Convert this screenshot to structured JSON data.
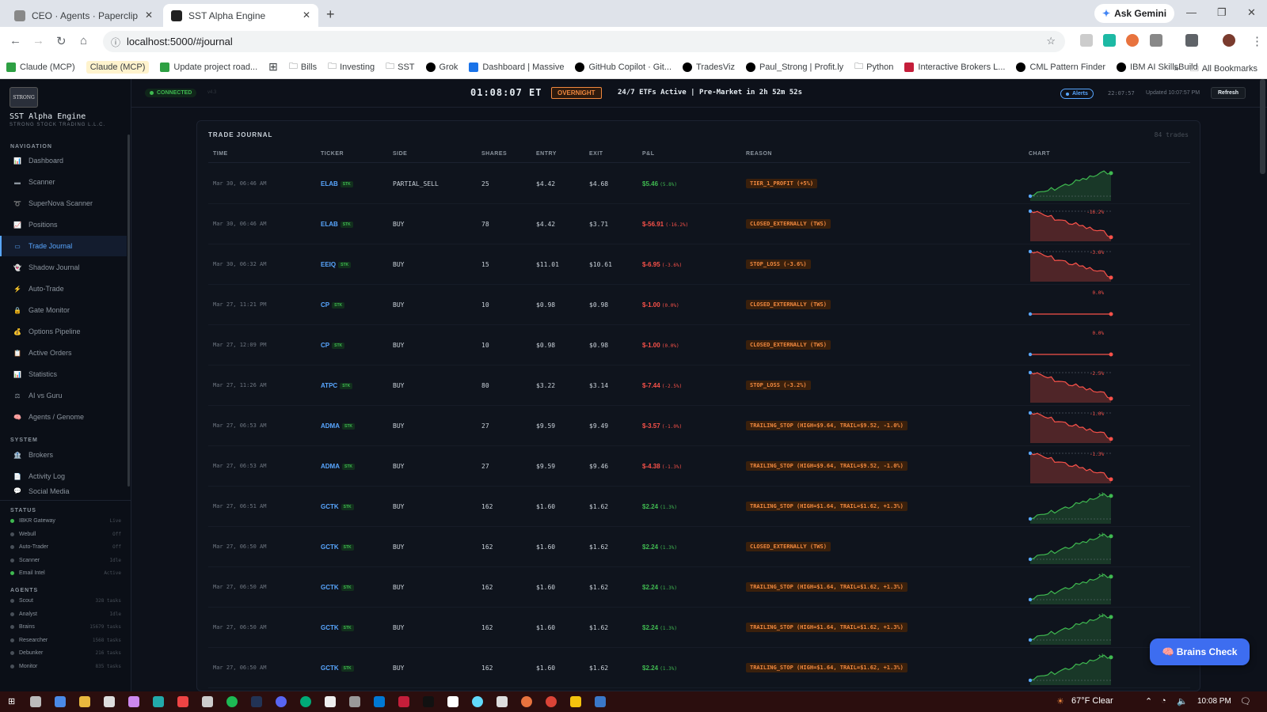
{
  "browser": {
    "tabs": [
      {
        "title": "CEO · Agents · Paperclip"
      },
      {
        "title": "SST Alpha Engine"
      }
    ],
    "ask_gemini": "Ask Gemini",
    "url": "localhost:5000/#journal",
    "bookmarks": [
      {
        "label": "Claude (MCP)",
        "color": "#2ea043",
        "highlight": false
      },
      {
        "label": "Claude (MCP)",
        "color": "",
        "highlight": true
      },
      {
        "label": "Update project road...",
        "color": "#2ea043",
        "highlight": false
      },
      {
        "label": "",
        "color": "#5f6368",
        "highlight": false,
        "icon": "apps-grid-icon"
      },
      {
        "label": "Bills",
        "color": "",
        "icon": "folder-icon"
      },
      {
        "label": "Investing",
        "color": "",
        "icon": "folder-icon"
      },
      {
        "label": "SST",
        "color": "",
        "icon": "folder-icon"
      },
      {
        "label": "Grok",
        "color": "#000000"
      },
      {
        "label": "Dashboard | Massive",
        "color": "#1a73e8"
      },
      {
        "label": "GitHub Copilot · Git...",
        "color": "#000000"
      },
      {
        "label": "TradesViz",
        "color": "#000000"
      },
      {
        "label": "Paul_Strong | Profit.ly",
        "color": "#000000"
      },
      {
        "label": "Python",
        "color": "",
        "icon": "folder-icon"
      },
      {
        "label": "Interactive Brokers L...",
        "color": "#c41e3a"
      },
      {
        "label": "CML Pattern Finder",
        "color": "#000000"
      },
      {
        "label": "IBM AI SkillsBuild",
        "color": "#000000"
      }
    ],
    "all_bookmarks": "All Bookmarks"
  },
  "sidebar": {
    "logo_text": "STRONG",
    "brand": "SST Alpha Engine",
    "brand_sub": "STRONG STOCK TRADING L.L.C.",
    "nav_title": "NAVIGATION",
    "nav": [
      {
        "label": "Dashboard",
        "icon": "📊",
        "active": false
      },
      {
        "label": "Scanner",
        "icon": "▬",
        "active": false
      },
      {
        "label": "SuperNova Scanner",
        "icon": "➰",
        "active": false
      },
      {
        "label": "Positions",
        "icon": "📈",
        "active": false
      },
      {
        "label": "Trade Journal",
        "icon": "▭",
        "active": true
      },
      {
        "label": "Shadow Journal",
        "icon": "👻",
        "active": false
      },
      {
        "label": "Auto-Trade",
        "icon": "⚡",
        "active": false
      },
      {
        "label": "Gate Monitor",
        "icon": "🔒",
        "active": false
      },
      {
        "label": "Options Pipeline",
        "icon": "💰",
        "active": false
      },
      {
        "label": "Active Orders",
        "icon": "📋",
        "active": false
      },
      {
        "label": "Statistics",
        "icon": "📊",
        "active": false
      },
      {
        "label": "AI vs Guru",
        "icon": "⚖",
        "active": false
      },
      {
        "label": "Agents / Genome",
        "icon": "🧠",
        "active": false
      }
    ],
    "system_title": "SYSTEM",
    "system": [
      {
        "label": "Brokers",
        "icon": "🏦"
      },
      {
        "label": "Activity Log",
        "icon": "📄"
      },
      {
        "label": "Social Media",
        "icon": "💬"
      }
    ],
    "status_title": "STATUS",
    "status": [
      {
        "label": "IBKR Gateway",
        "value": "Live",
        "color": "#3fb950"
      },
      {
        "label": "Webull",
        "value": "Off",
        "color": "#484f58"
      },
      {
        "label": "Auto-Trader",
        "value": "Off",
        "color": "#484f58"
      },
      {
        "label": "Scanner",
        "value": "Idle",
        "color": "#484f58"
      },
      {
        "label": "Email Intel",
        "value": "Active",
        "color": "#3fb950"
      }
    ],
    "agents_title": "AGENTS",
    "agents": [
      {
        "label": "Scout",
        "value": "328 tasks",
        "color": "#484f58"
      },
      {
        "label": "Analyst",
        "value": "Idle",
        "color": "#484f58"
      },
      {
        "label": "Brains",
        "value": "15679 tasks",
        "color": "#484f58"
      },
      {
        "label": "Researcher",
        "value": "1568 tasks",
        "color": "#484f58"
      },
      {
        "label": "Debunker",
        "value": "216 tasks",
        "color": "#484f58"
      },
      {
        "label": "Monitor",
        "value": "835 tasks",
        "color": "#484f58"
      }
    ]
  },
  "topbar": {
    "connected": "CONNECTED",
    "version": "v4.3",
    "clock": "01:08:07 ET",
    "session": "OVERNIGHT",
    "market": "24/7 ETFs Active | Pre-Market in 2h 52m 52s",
    "alerts": "Alerts",
    "time": "22:07:57",
    "updated": "Updated 10:07:57 PM",
    "refresh": "Refresh"
  },
  "journal": {
    "title": "TRADE JOURNAL",
    "count": "84 trades",
    "headers": [
      "TIME",
      "TICKER",
      "SIDE",
      "SHARES",
      "ENTRY",
      "EXIT",
      "P&L",
      "REASON",
      "CHART"
    ],
    "rows": [
      {
        "time": "Mar 30, 06:46 AM",
        "ticker": "ELAB",
        "badge": "STK",
        "side": "PARTIAL_SELL",
        "shares": "25",
        "entry": "$4.42",
        "exit": "$4.68",
        "pnl": "$5.46",
        "pct": "(5.8%)",
        "reason": "TIER_1_PROFIT (+5%)",
        "positive": true,
        "chart_label": "",
        "trend": "up"
      },
      {
        "time": "Mar 30, 06:46 AM",
        "ticker": "ELAB",
        "badge": "STK",
        "side": "BUY",
        "shares": "78",
        "entry": "$4.42",
        "exit": "$3.71",
        "pnl": "$-56.91",
        "pct": "(-16.2%)",
        "reason": "CLOSED_EXTERNALLY (TWS)",
        "positive": false,
        "chart_label": "-16.2%",
        "trend": "down"
      },
      {
        "time": "Mar 30, 06:32 AM",
        "ticker": "EEIQ",
        "badge": "STK",
        "side": "BUY",
        "shares": "15",
        "entry": "$11.01",
        "exit": "$10.61",
        "pnl": "$-6.95",
        "pct": "(-3.6%)",
        "reason": "STOP_LOSS (-3.6%)",
        "positive": false,
        "chart_label": "-3.6%",
        "trend": "down"
      },
      {
        "time": "Mar 27, 11:21 PM",
        "ticker": "CP",
        "badge": "STK",
        "side": "BUY",
        "shares": "10",
        "entry": "$0.98",
        "exit": "$0.98",
        "pnl": "$-1.00",
        "pct": "(0.0%)",
        "reason": "CLOSED_EXTERNALLY (TWS)",
        "positive": false,
        "chart_label": "0.0%",
        "trend": "flat"
      },
      {
        "time": "Mar 27, 12:09 PM",
        "ticker": "CP",
        "badge": "STK",
        "side": "BUY",
        "shares": "10",
        "entry": "$0.98",
        "exit": "$0.98",
        "pnl": "$-1.00",
        "pct": "(0.0%)",
        "reason": "CLOSED_EXTERNALLY (TWS)",
        "positive": false,
        "chart_label": "0.0%",
        "trend": "flat"
      },
      {
        "time": "Mar 27, 11:26 AM",
        "ticker": "ATPC",
        "badge": "STK",
        "side": "BUY",
        "shares": "80",
        "entry": "$3.22",
        "exit": "$3.14",
        "pnl": "$-7.44",
        "pct": "(-2.5%)",
        "reason": "STOP_LOSS (-3.2%)",
        "positive": false,
        "chart_label": "-2.5%",
        "trend": "down"
      },
      {
        "time": "Mar 27, 06:53 AM",
        "ticker": "ADMA",
        "badge": "STK",
        "side": "BUY",
        "shares": "27",
        "entry": "$9.59",
        "exit": "$9.49",
        "pnl": "$-3.57",
        "pct": "(-1.0%)",
        "reason": "TRAILING_STOP (HIGH=$9.64, TRAIL=$9.52, -1.0%)",
        "positive": false,
        "chart_label": "-1.0%",
        "trend": "down"
      },
      {
        "time": "Mar 27, 06:53 AM",
        "ticker": "ADMA",
        "badge": "STK",
        "side": "BUY",
        "shares": "27",
        "entry": "$9.59",
        "exit": "$9.46",
        "pnl": "$-4.38",
        "pct": "(-1.3%)",
        "reason": "TRAILING_STOP (HIGH=$9.64, TRAIL=$9.52, -1.0%)",
        "positive": false,
        "chart_label": "-1.3%",
        "trend": "down"
      },
      {
        "time": "Mar 27, 06:51 AM",
        "ticker": "GCTK",
        "badge": "STK",
        "side": "BUY",
        "shares": "162",
        "entry": "$1.60",
        "exit": "$1.62",
        "pnl": "$2.24",
        "pct": "(1.3%)",
        "reason": "TRAILING_STOP (HIGH=$1.64, TRAIL=$1.62, +1.3%)",
        "positive": true,
        "chart_label": "+1",
        "trend": "up"
      },
      {
        "time": "Mar 27, 06:50 AM",
        "ticker": "GCTK",
        "badge": "STK",
        "side": "BUY",
        "shares": "162",
        "entry": "$1.60",
        "exit": "$1.62",
        "pnl": "$2.24",
        "pct": "(1.3%)",
        "reason": "CLOSED_EXTERNALLY (TWS)",
        "positive": true,
        "chart_label": "+1",
        "trend": "up"
      },
      {
        "time": "Mar 27, 06:50 AM",
        "ticker": "GCTK",
        "badge": "STK",
        "side": "BUY",
        "shares": "162",
        "entry": "$1.60",
        "exit": "$1.62",
        "pnl": "$2.24",
        "pct": "(1.3%)",
        "reason": "TRAILING_STOP (HIGH=$1.64, TRAIL=$1.62, +1.3%)",
        "positive": true,
        "chart_label": "+1",
        "trend": "up"
      },
      {
        "time": "Mar 27, 06:50 AM",
        "ticker": "GCTK",
        "badge": "STK",
        "side": "BUY",
        "shares": "162",
        "entry": "$1.60",
        "exit": "$1.62",
        "pnl": "$2.24",
        "pct": "(1.3%)",
        "reason": "TRAILING_STOP (HIGH=$1.64, TRAIL=$1.62, +1.3%)",
        "positive": true,
        "chart_label": "+1",
        "trend": "up"
      },
      {
        "time": "Mar 27, 06:50 AM",
        "ticker": "GCTK",
        "badge": "STK",
        "side": "BUY",
        "shares": "162",
        "entry": "$1.60",
        "exit": "$1.62",
        "pnl": "$2.24",
        "pct": "(1.3%)",
        "reason": "TRAILING_STOP (HIGH=$1.64, TRAIL=$1.62, +1.3%)",
        "positive": true,
        "chart_label": "+1",
        "trend": "up"
      }
    ]
  },
  "brains_check": "🧠 Brains Check",
  "taskbar": {
    "weather": "67°F  Clear",
    "time": "10:08 PM"
  },
  "colors": {
    "accent": "#58a6ff",
    "positive": "#3fb950",
    "negative": "#f85149",
    "warning": "#f0883e"
  }
}
